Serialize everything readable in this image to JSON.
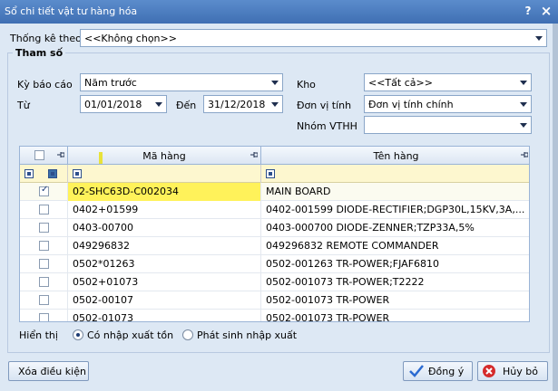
{
  "window": {
    "title": "Sổ chi tiết vật tư hàng hóa",
    "help_glyph": "?",
    "close_glyph": "×"
  },
  "stat_by": {
    "label": "Thống kê theo",
    "value": "<<Không chọn>>"
  },
  "params": {
    "group_title": "Tham số",
    "report_period": {
      "label": "Kỳ báo cáo",
      "value": "Năm trước"
    },
    "from": {
      "label": "Từ",
      "value": "01/01/2018"
    },
    "to": {
      "label": "Đến",
      "value": "31/12/2018"
    },
    "warehouse": {
      "label": "Kho",
      "value": "<<Tất cả>>"
    },
    "unit": {
      "label": "Đơn vị tính",
      "value": "Đơn vị tính chính"
    },
    "group": {
      "label": "Nhóm VTHH",
      "value": ""
    }
  },
  "grid": {
    "columns": [
      "Mã hàng",
      "Tên hàng"
    ],
    "rows": [
      {
        "checked": true,
        "code": "02-SHC63D-C002034",
        "name": "MAIN BOARD"
      },
      {
        "checked": false,
        "code": "0402+01599",
        "name": "0402-001599  DIODE-RECTIFIER;DGP30L,15KV,3A,..."
      },
      {
        "checked": false,
        "code": "0403-00700",
        "name": "0403-000700 DIODE-ZENNER;TZP33A,5%"
      },
      {
        "checked": false,
        "code": "049296832",
        "name": "049296832 REMOTE COMMANDER"
      },
      {
        "checked": false,
        "code": "0502*01263",
        "name": "0502-001263 TR-POWER;FJAF6810"
      },
      {
        "checked": false,
        "code": "0502+01073",
        "name": "0502-001073 TR-POWER;T2222"
      },
      {
        "checked": false,
        "code": "0502-00107",
        "name": "0502-001073  TR-POWER"
      },
      {
        "checked": false,
        "code": "0502-01073",
        "name": "0502-001073 TR-POWER"
      }
    ]
  },
  "display": {
    "label": "Hiển thị",
    "option1": "Có nhập xuất tồn",
    "option2": "Phát sinh nhập xuất",
    "selected": 1
  },
  "buttons": {
    "clear": "Xóa điều kiện",
    "ok": "Đồng ý",
    "cancel": "Hủy bỏ"
  },
  "colors": {
    "accent": "#3f6fb3",
    "highlight": "#fff25a",
    "filter_row": "#fdf7cf"
  }
}
